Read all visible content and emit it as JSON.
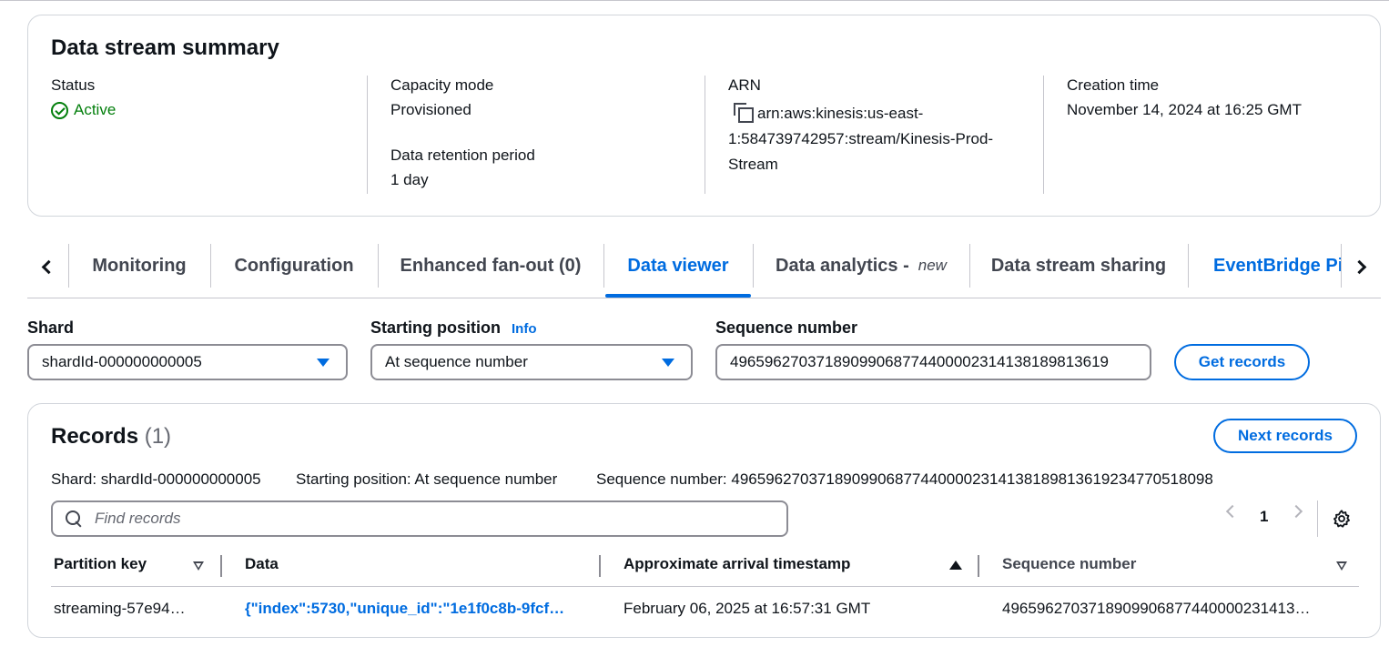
{
  "summary": {
    "title": "Data stream summary",
    "status_label": "Status",
    "status_value": "Active",
    "capacity_label": "Capacity mode",
    "capacity_value": "Provisioned",
    "retention_label": "Data retention period",
    "retention_value": "1 day",
    "arn_label": "ARN",
    "arn_value": "arn:aws:kinesis:us-east-1:584739742957:stream/Kinesis-Prod-Stream",
    "creation_label": "Creation time",
    "creation_value": "November 14, 2024 at 16:25 GMT"
  },
  "tabs": {
    "items": [
      {
        "label": "Monitoring"
      },
      {
        "label": "Configuration"
      },
      {
        "label": "Enhanced fan-out (0)"
      },
      {
        "label": "Data viewer"
      },
      {
        "label": "Data analytics -",
        "tag": "new"
      },
      {
        "label": "Data stream sharing"
      },
      {
        "label": "EventBridge Pi"
      }
    ],
    "active": "Data viewer"
  },
  "form": {
    "shard_label": "Shard",
    "shard_value": "shardId-000000000005",
    "position_label": "Starting position",
    "info_link": "Info",
    "position_value": "At sequence number",
    "sequence_label": "Sequence number",
    "sequence_value": "49659627037189099068774400002314138189813619",
    "get_records": "Get records"
  },
  "records": {
    "title": "Records",
    "count": "(1)",
    "next_button": "Next records",
    "meta_shard": "Shard: shardId-000000000005",
    "meta_position": "Starting position: At sequence number",
    "meta_sequence": "Sequence number: 49659627037189099068774400002314138189813619234770518098",
    "search_placeholder": "Find records",
    "page": "1",
    "columns": [
      "Partition key",
      "Data",
      "Approximate arrival timestamp",
      "Sequence number"
    ],
    "rows": [
      {
        "partition_key": "streaming-57e94…",
        "data": "{\"index\":5730,\"unique_id\":\"1e1f0c8b-9fcf…",
        "timestamp": "February 06, 2025 at 16:57:31 GMT",
        "sequence": "4965962703718909906877440000231413…"
      }
    ]
  },
  "colors": {
    "accent": "#006ce0",
    "success": "#037f0c",
    "text": "#0f141a",
    "muted": "#424650"
  }
}
